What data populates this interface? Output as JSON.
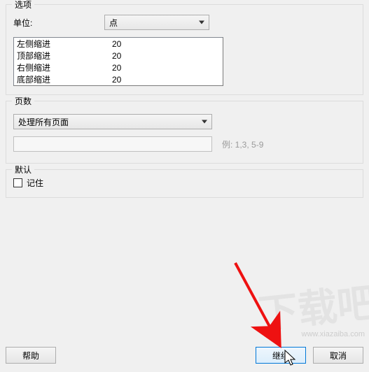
{
  "options": {
    "legend": "选项",
    "unit_label": "单位:",
    "unit_value": "点",
    "margins": [
      {
        "k": "左侧缩进",
        "v": "20"
      },
      {
        "k": "顶部缩进",
        "v": "20"
      },
      {
        "k": "右侧缩进",
        "v": "20"
      },
      {
        "k": "底部缩进",
        "v": "20"
      }
    ]
  },
  "pages": {
    "legend": "页数",
    "scope_value": "处理所有页面",
    "range_value": "",
    "range_hint": "例: 1,3, 5-9"
  },
  "defaults": {
    "legend": "默认",
    "remember_label": "记住"
  },
  "buttons": {
    "help": "帮助",
    "continue": "继续",
    "cancel": "取消"
  },
  "watermark": {
    "big": "下载吧",
    "url": "www.xiazaiba.com"
  }
}
